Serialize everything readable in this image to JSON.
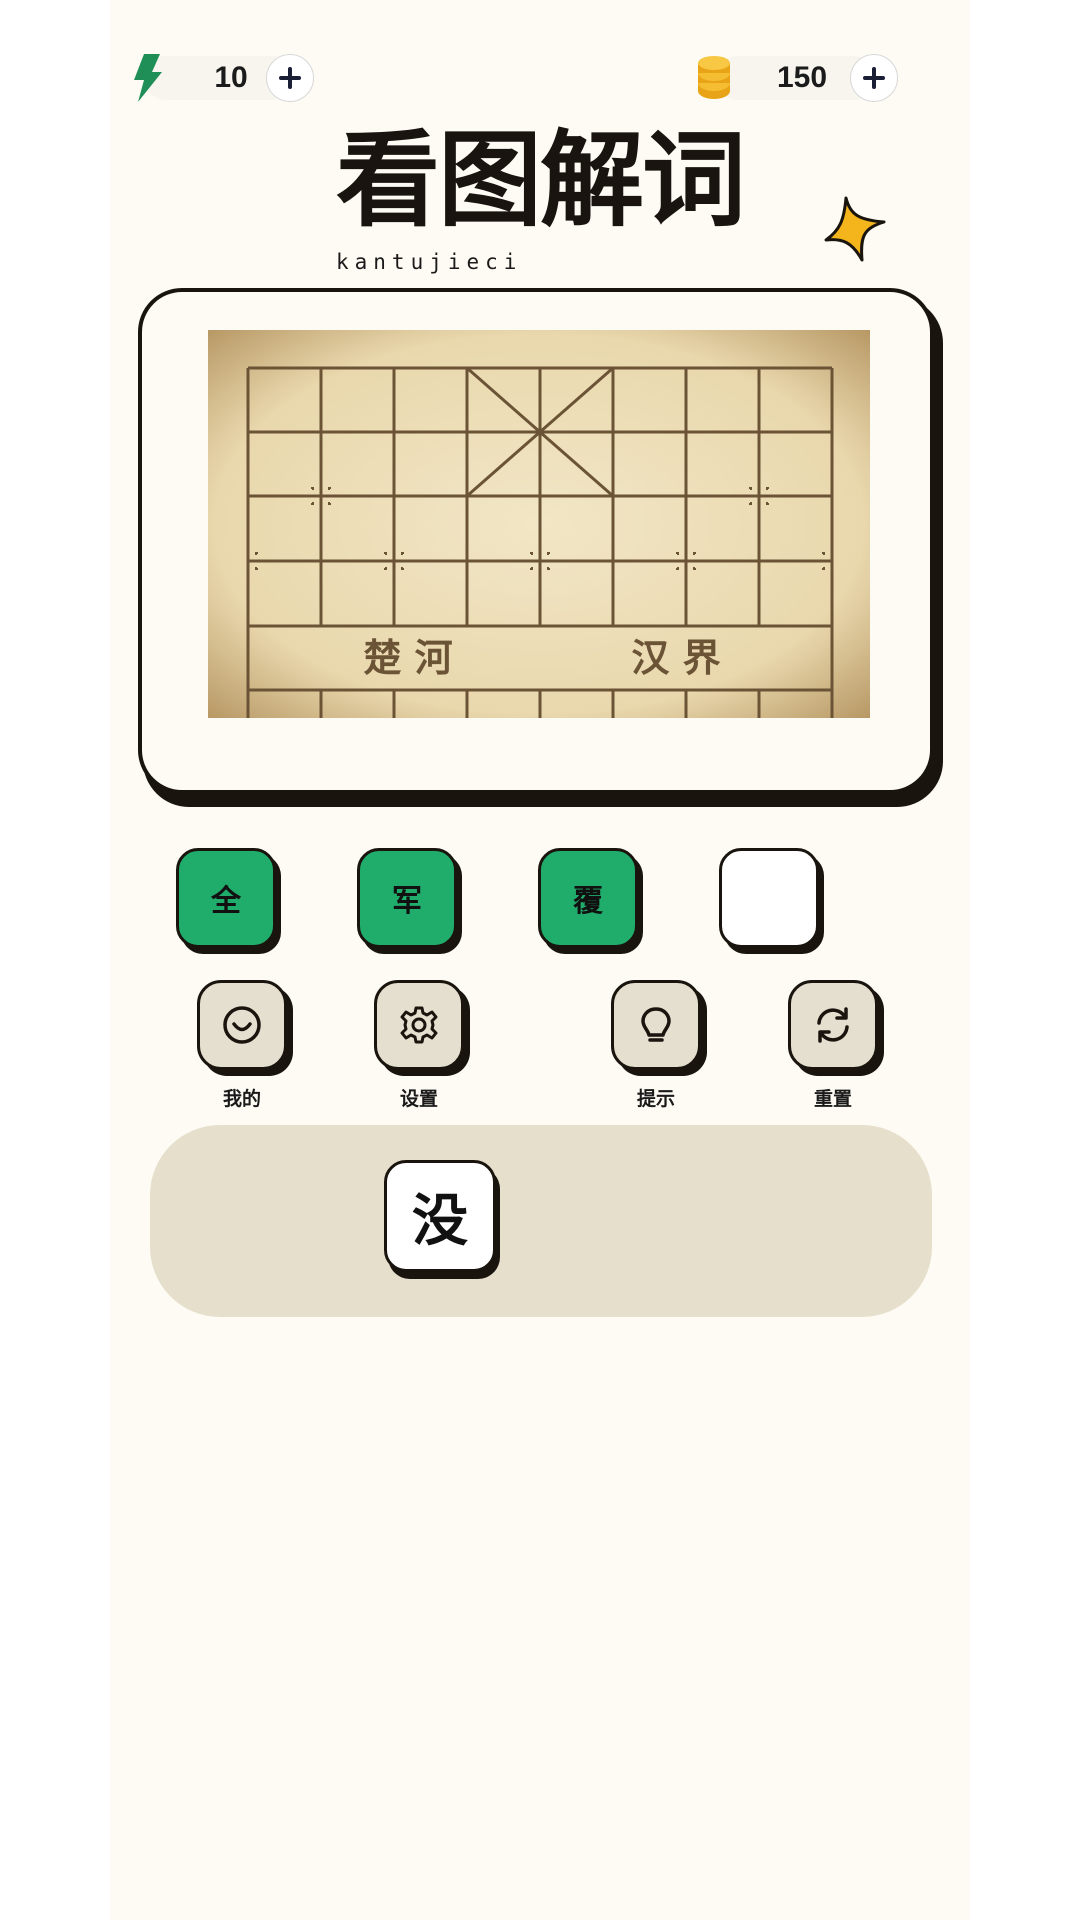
{
  "topbar": {
    "energy": {
      "icon": "lightning-icon",
      "value": "10",
      "color": "#1f8f57"
    },
    "coins": {
      "icon": "coins-icon",
      "value": "150",
      "color": "#f0b429"
    }
  },
  "header": {
    "title": "看图解词",
    "subtitle": "kantujieci"
  },
  "puzzle": {
    "image": "chinese-chess-board",
    "board_text_left": "楚 河",
    "board_text_right": "汉 界"
  },
  "answer": {
    "slots": [
      {
        "char": "全",
        "state": "filled"
      },
      {
        "char": "军",
        "state": "filled"
      },
      {
        "char": "覆",
        "state": "filled"
      },
      {
        "char": "",
        "state": "empty"
      }
    ],
    "filled_color": "#20ad6c"
  },
  "tools": [
    {
      "label": "我的",
      "icon": "smile-icon"
    },
    {
      "label": "设置",
      "icon": "gear-icon"
    },
    {
      "label": "提示",
      "icon": "lightbulb-icon"
    },
    {
      "label": "重置",
      "icon": "refresh-icon"
    }
  ],
  "tray": {
    "tiles": [
      "没"
    ]
  }
}
